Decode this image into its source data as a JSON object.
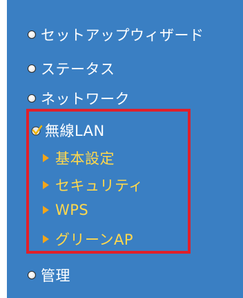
{
  "menu": {
    "items": [
      {
        "label": "セットアップウィザード"
      },
      {
        "label": "ステータス"
      },
      {
        "label": "ネットワーク"
      }
    ],
    "wireless": {
      "label": "無線LAN",
      "sub_items": [
        {
          "label": "基本設定"
        },
        {
          "label": "セキュリティ"
        },
        {
          "label": "WPS"
        },
        {
          "label": "グリーンAP"
        }
      ]
    },
    "admin": {
      "label": "管理"
    }
  },
  "colors": {
    "panel_bg": "#3a7fc3",
    "menu_text": "#ffffff",
    "sub_text": "#ffd84d",
    "arrow": "#f2a51a",
    "highlight_border": "#e0202a"
  },
  "icons": {
    "bullet": "radio-bullet-icon",
    "expanded": "checkmark-icon",
    "sub_bullet": "triangle-arrow-icon"
  }
}
